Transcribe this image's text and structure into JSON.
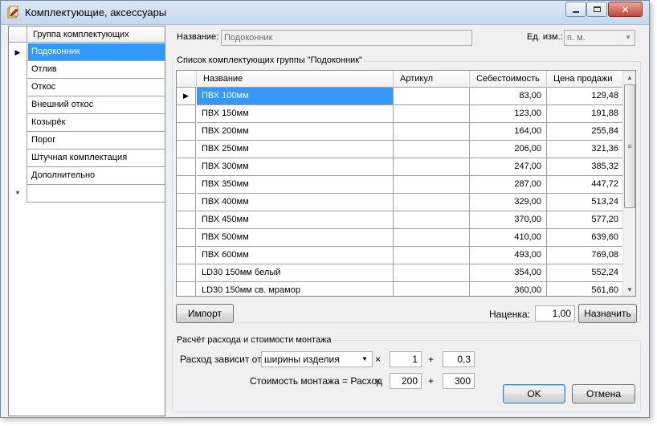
{
  "window": {
    "title": "Комплектующие, аксессуары"
  },
  "groups": {
    "header": "Группа комплектующих",
    "items": [
      "Подоконник",
      "Отлив",
      "Откос",
      "Внешний откос",
      "Козырёк",
      "Порог",
      "Штучная комплектация",
      "Дополнительно"
    ],
    "selected_index": 0,
    "new_row_marker": "*",
    "current_row_marker": "▶"
  },
  "header": {
    "name_label": "Название:",
    "name_value": "Подоконник",
    "unit_label": "Ед. изм.:",
    "unit_value": "п. м."
  },
  "list": {
    "title": "Список комплектующих группы \"Подоконник\"",
    "columns": [
      "Название",
      "Артикул",
      "Себестоимость",
      "Цена продажи"
    ],
    "rows": [
      {
        "name": "ПВХ 100мм",
        "article": "",
        "cost": "83,00",
        "price": "129,48"
      },
      {
        "name": "ПВХ 150мм",
        "article": "",
        "cost": "123,00",
        "price": "191,88"
      },
      {
        "name": "ПВХ 200мм",
        "article": "",
        "cost": "164,00",
        "price": "255,84"
      },
      {
        "name": "ПВХ 250мм",
        "article": "",
        "cost": "206,00",
        "price": "321,36"
      },
      {
        "name": "ПВХ 300мм",
        "article": "",
        "cost": "247,00",
        "price": "385,32"
      },
      {
        "name": "ПВХ 350мм",
        "article": "",
        "cost": "287,00",
        "price": "447,72"
      },
      {
        "name": "ПВХ 400мм",
        "article": "",
        "cost": "329,00",
        "price": "513,24"
      },
      {
        "name": "ПВХ 450мм",
        "article": "",
        "cost": "370,00",
        "price": "577,20"
      },
      {
        "name": "ПВХ 500мм",
        "article": "",
        "cost": "410,00",
        "price": "639,60"
      },
      {
        "name": "ПВХ 600мм",
        "article": "",
        "cost": "493,00",
        "price": "769,08"
      },
      {
        "name": "LD30 150мм белый",
        "article": "",
        "cost": "354,00",
        "price": "552,24"
      },
      {
        "name": "LD30 150мм св. мрамор",
        "article": "",
        "cost": "360,00",
        "price": "561,60"
      }
    ]
  },
  "actions": {
    "import_label": "Импорт",
    "markup_label": "Наценка:",
    "markup_value": "1,00",
    "assign_label": "Назначить"
  },
  "install": {
    "title": "Расчёт расхода и стоимости монтажа",
    "depends_label": "Расход зависит от:",
    "depends_value": "ширины изделия",
    "mult_sign": "×",
    "plus_sign": "+",
    "factor1": "1",
    "addend1": "0,3",
    "cost_label": "Стоимость монтажа = Расход",
    "factor2": "200",
    "addend2": "300"
  },
  "buttons": {
    "ok": "OK",
    "cancel": "Отмена"
  }
}
